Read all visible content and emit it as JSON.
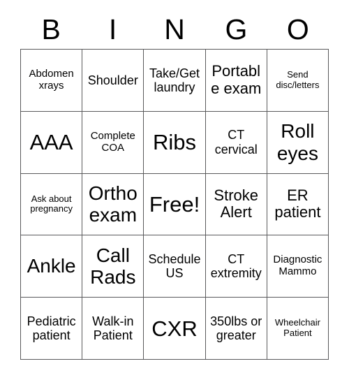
{
  "header": {
    "letters": [
      "B",
      "I",
      "N",
      "G",
      "O"
    ]
  },
  "grid": {
    "columns": 5,
    "rows": 5,
    "cells": [
      [
        {
          "text": "Abdomen xrays",
          "size": "sm"
        },
        {
          "text": "Shoulder",
          "size": "md"
        },
        {
          "text": "Take/Get laundry",
          "size": "md"
        },
        {
          "text": "Portable exam",
          "size": "lg"
        },
        {
          "text": "Send disc/letters",
          "size": "xs"
        }
      ],
      [
        {
          "text": "AAA",
          "size": "xxl"
        },
        {
          "text": "Complete COA",
          "size": "sm"
        },
        {
          "text": "Ribs",
          "size": "xxl"
        },
        {
          "text": "CT cervical",
          "size": "md"
        },
        {
          "text": "Roll eyes",
          "size": "xl"
        }
      ],
      [
        {
          "text": "Ask about pregnancy",
          "size": "xs"
        },
        {
          "text": "Ortho exam",
          "size": "xl"
        },
        {
          "text": "Free!",
          "size": "xxl"
        },
        {
          "text": "Stroke Alert",
          "size": "lg"
        },
        {
          "text": "ER patient",
          "size": "lg"
        }
      ],
      [
        {
          "text": "Ankle",
          "size": "xl"
        },
        {
          "text": "Call Rads",
          "size": "xl"
        },
        {
          "text": "Schedule US",
          "size": "md"
        },
        {
          "text": "CT extremity",
          "size": "md"
        },
        {
          "text": "Diagnostic Mammo",
          "size": "sm"
        }
      ],
      [
        {
          "text": "Pediatric patient",
          "size": "md"
        },
        {
          "text": "Walk-in Patient",
          "size": "md"
        },
        {
          "text": "CXR",
          "size": "xxl"
        },
        {
          "text": "350lbs or greater",
          "size": "md"
        },
        {
          "text": "Wheelchair Patient",
          "size": "xs"
        }
      ]
    ]
  },
  "colors": {
    "border": "#59595b",
    "text": "#000000",
    "background": "#ffffff"
  }
}
